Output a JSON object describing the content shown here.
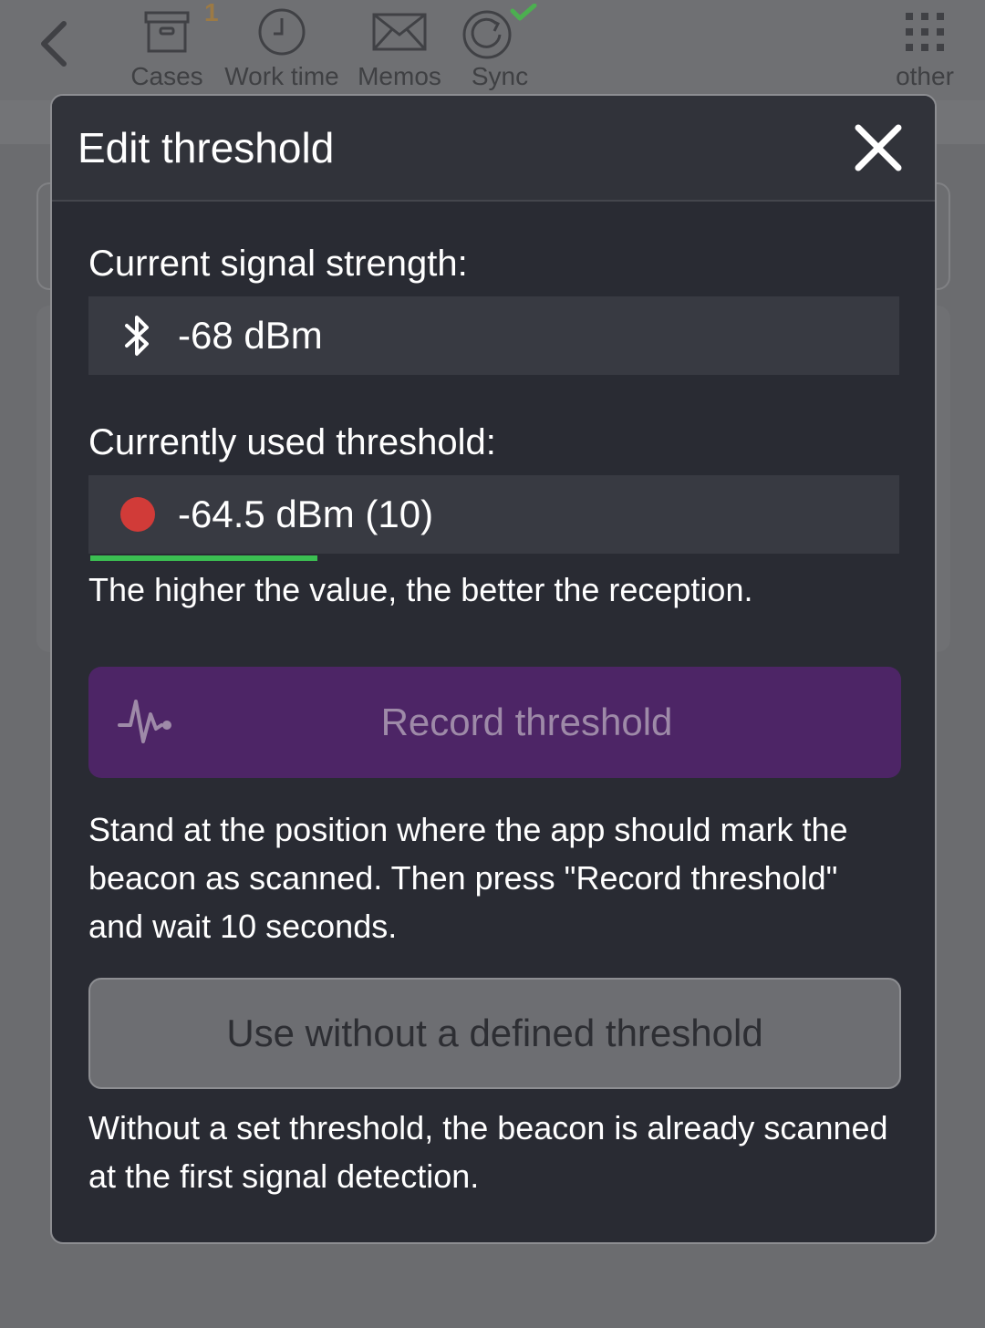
{
  "topbar": {
    "nav": [
      {
        "label": "Cases",
        "icon": "archive-box-icon"
      },
      {
        "label": "Work time",
        "icon": "clock-icon"
      },
      {
        "label": "Memos",
        "icon": "envelope-icon"
      },
      {
        "label": "Sync",
        "icon": "sync-icon"
      },
      {
        "label": "other",
        "icon": "grid-icon"
      }
    ],
    "cases_badge": "1"
  },
  "modal": {
    "title": "Edit threshold",
    "signal_label": "Current signal strength:",
    "signal_value": "-68 dBm",
    "threshold_label": "Currently used threshold:",
    "threshold_value": "-64.5 dBm (10)",
    "threshold_progress": 0.28,
    "hint": "The higher the value, the better the reception.",
    "record_button": "Record threshold",
    "instructions": "Stand at the position where the app should mark the beacon as scanned. Then press \"Record threshold\" and wait 10 seconds.",
    "use_button": "Use without a defined threshold",
    "footer_note": "Without a set threshold, the beacon is already scanned at the first signal detection."
  },
  "colors": {
    "modal_bg": "#292b33",
    "value_box_bg": "#383a42",
    "record_button_bg": "#4d2566",
    "status_dot": "#d13b38",
    "progress_green": "#3bbf52",
    "sync_check": "#4caf50",
    "badge": "#9c7a45"
  }
}
